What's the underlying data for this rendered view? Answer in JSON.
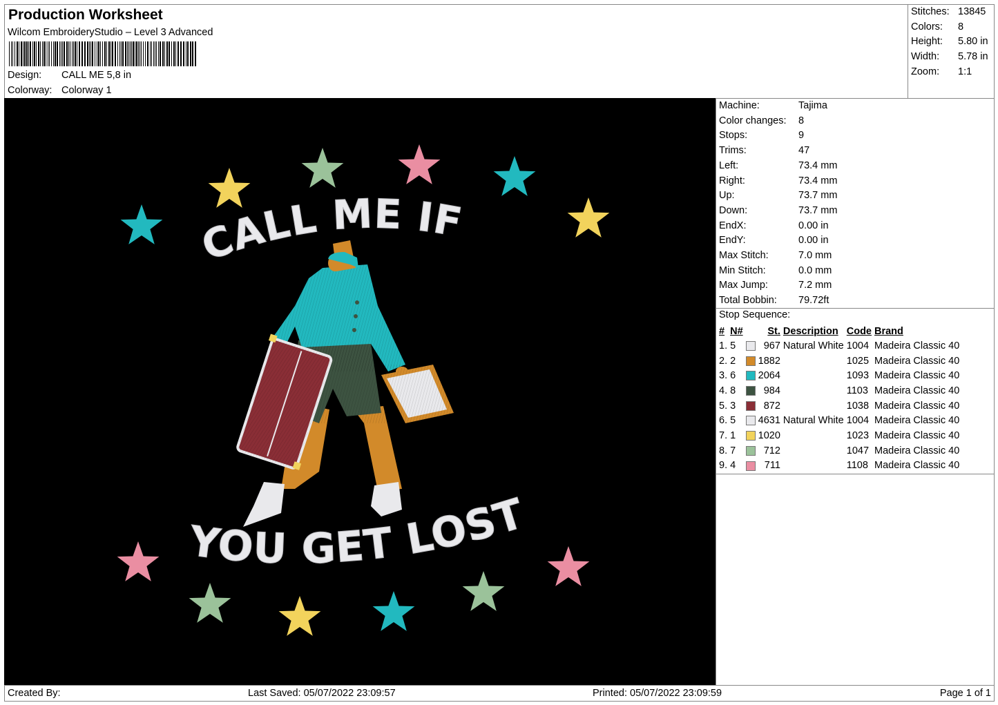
{
  "header": {
    "title": "Production Worksheet",
    "software": "Wilcom EmbroideryStudio – Level 3 Advanced",
    "design_label": "Design:",
    "design_value": "CALL ME 5,8 in",
    "colorway_label": "Colorway:",
    "colorway_value": "Colorway 1"
  },
  "summary": {
    "stitches_label": "Stitches:",
    "stitches_value": "13845",
    "colors_label": "Colors:",
    "colors_value": "8",
    "height_label": "Height:",
    "height_value": "5.80 in",
    "width_label": "Width:",
    "width_value": "5.78 in",
    "zoom_label": "Zoom:",
    "zoom_value": "1:1"
  },
  "machine": [
    {
      "label": "Machine:",
      "value": "Tajima"
    },
    {
      "label": "Color changes:",
      "value": "8"
    },
    {
      "label": "Stops:",
      "value": "9"
    },
    {
      "label": "Trims:",
      "value": "47"
    },
    {
      "label": "Left:",
      "value": "73.4 mm"
    },
    {
      "label": "Right:",
      "value": "73.4 mm"
    },
    {
      "label": "Up:",
      "value": "73.7 mm"
    },
    {
      "label": "Down:",
      "value": "73.7 mm"
    },
    {
      "label": "EndX:",
      "value": "0.00 in"
    },
    {
      "label": "EndY:",
      "value": "0.00 in"
    },
    {
      "label": "Max Stitch:",
      "value": "7.0 mm"
    },
    {
      "label": "Min Stitch:",
      "value": "0.0 mm"
    },
    {
      "label": "Max Jump:",
      "value": "7.2 mm"
    },
    {
      "label": "Total Bobbin:",
      "value": "79.72ft"
    }
  ],
  "stop_sequence": {
    "title": "Stop Sequence:",
    "headers": {
      "num": "#",
      "needle": "N#",
      "stitches": "St.",
      "description": "Description",
      "code": "Code",
      "brand": "Brand"
    },
    "rows": [
      {
        "num": "1.",
        "needle": "5",
        "color": "#e9e9ec",
        "stitches": "967",
        "description": "Natural White",
        "code": "1004",
        "brand": "Madeira Classic 40"
      },
      {
        "num": "2.",
        "needle": "2",
        "color": "#d28a2a",
        "stitches": "1882",
        "description": "",
        "code": "1025",
        "brand": "Madeira Classic 40"
      },
      {
        "num": "3.",
        "needle": "6",
        "color": "#22b9bf",
        "stitches": "2064",
        "description": "",
        "code": "1093",
        "brand": "Madeira Classic 40"
      },
      {
        "num": "4.",
        "needle": "8",
        "color": "#3d5341",
        "stitches": "984",
        "description": "",
        "code": "1103",
        "brand": "Madeira Classic 40"
      },
      {
        "num": "5.",
        "needle": "3",
        "color": "#8a2e36",
        "stitches": "872",
        "description": "",
        "code": "1038",
        "brand": "Madeira Classic 40"
      },
      {
        "num": "6.",
        "needle": "5",
        "color": "#e9e9ec",
        "stitches": "4631",
        "description": "Natural White",
        "code": "1004",
        "brand": "Madeira Classic 40"
      },
      {
        "num": "7.",
        "needle": "1",
        "color": "#f2d35c",
        "stitches": "1020",
        "description": "",
        "code": "1023",
        "brand": "Madeira Classic 40"
      },
      {
        "num": "8.",
        "needle": "7",
        "color": "#9bc29a",
        "stitches": "712",
        "description": "",
        "code": "1047",
        "brand": "Madeira Classic 40"
      },
      {
        "num": "9.",
        "needle": "4",
        "color": "#ea8ea2",
        "stitches": "711",
        "description": "",
        "code": "1108",
        "brand": "Madeira Classic 40"
      }
    ]
  },
  "design_text": {
    "top": "CALL ME IF",
    "bottom": "YOU GET LOST"
  },
  "footer": {
    "created_by": "Created By:",
    "last_saved": "Last Saved: 05/07/2022 23:09:57",
    "printed": "Printed: 05/07/2022 23:09:59",
    "page": "Page 1 of 1"
  }
}
